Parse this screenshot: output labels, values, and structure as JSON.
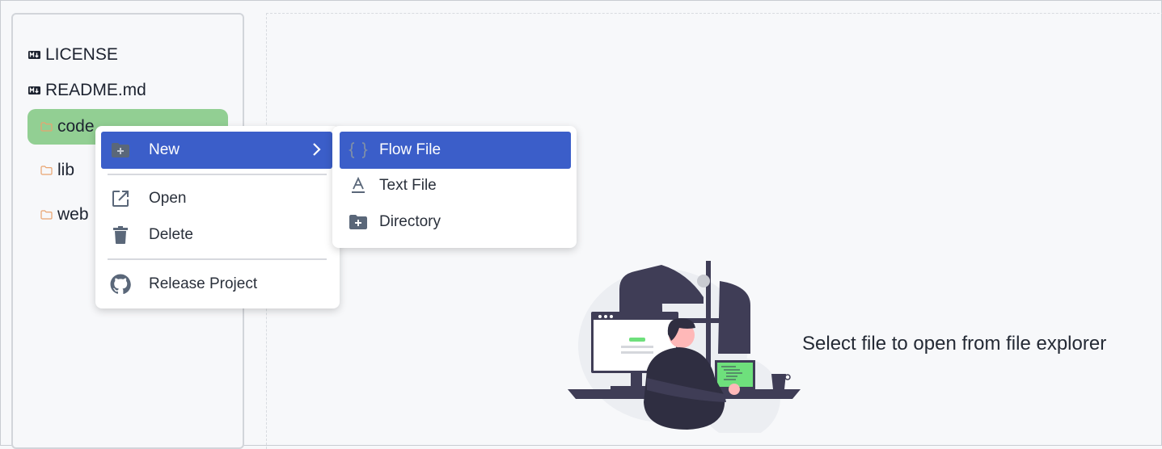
{
  "explorer": {
    "items": [
      {
        "label": "LICENSE",
        "icon": "markdown-icon"
      },
      {
        "label": "README.md",
        "icon": "markdown-icon"
      },
      {
        "label": "code",
        "icon": "folder-icon",
        "selected": true
      },
      {
        "label": "lib",
        "icon": "folder-icon"
      },
      {
        "label": "web",
        "icon": "folder-icon"
      }
    ]
  },
  "context_menu": {
    "items": [
      {
        "label": "New",
        "icon": "folder-plus-icon",
        "has_submenu": true
      },
      {
        "label": "Open",
        "icon": "external-link-icon"
      },
      {
        "label": "Delete",
        "icon": "trash-icon"
      },
      {
        "label": "Release Project",
        "icon": "github-icon"
      }
    ]
  },
  "submenu": {
    "items": [
      {
        "label": "Flow File",
        "icon": "braces-icon"
      },
      {
        "label": "Text File",
        "icon": "text-icon"
      },
      {
        "label": "Directory",
        "icon": "folder-plus-icon"
      }
    ]
  },
  "editor": {
    "empty_message": "Select file to open from file explorer"
  },
  "colors": {
    "accent": "#3b5ec9",
    "selected": "#92cf93",
    "folder": "#e9a36f"
  }
}
